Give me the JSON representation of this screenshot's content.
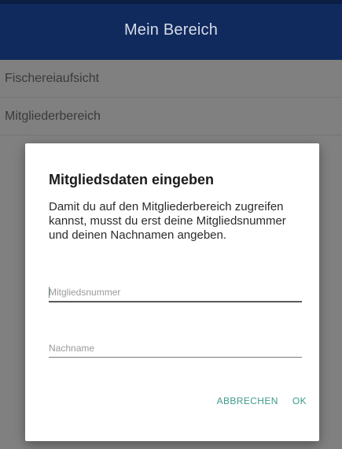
{
  "app_bar": {
    "title": "Mein Bereich"
  },
  "list": {
    "items": [
      {
        "label": "Fischereiaufsicht"
      },
      {
        "label": "Mitgliederbereich"
      }
    ]
  },
  "dialog": {
    "title": "Mitgliedsdaten eingeben",
    "message": "Damit du auf den Mitgliederbereich zugreifen kannst, musst du erst deine Mitgliedsnummer und deinen Nachnamen angeben.",
    "member_number": {
      "value": "",
      "placeholder": "Mitgliedsnummer"
    },
    "last_name": {
      "value": "",
      "placeholder": "Nachname"
    },
    "cancel_label": "ABBRECHEN",
    "ok_label": "OK"
  },
  "colors": {
    "app_bar": "#102a5d",
    "accent": "#3e9b8a",
    "scrim": "#808080"
  }
}
